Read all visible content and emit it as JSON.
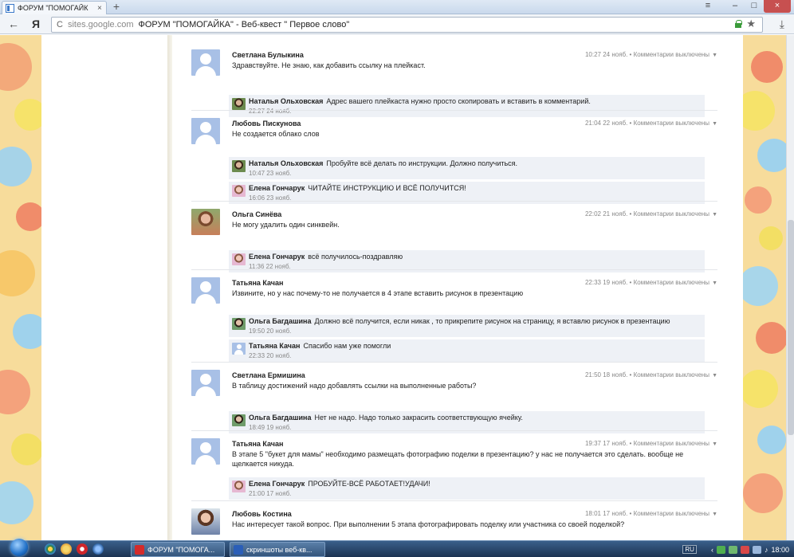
{
  "browser": {
    "tab_title": "ФОРУМ \"ПОМОГАЙК",
    "tab_close": "×",
    "new_tab": "+",
    "menu": "≡",
    "minimize": "–",
    "maximize": "□",
    "close": "×",
    "back": "←",
    "yandex": "Я",
    "reload": "C",
    "url_host": "sites.google.com",
    "url_title": "ФОРУМ \"ПОМОГАЙКА\" - Веб-квест \" Первое слово\"",
    "star": "★",
    "download": "⤓"
  },
  "comments": [
    {
      "author": "Светлана Булыкина",
      "text": "Здравствуйте. Не знаю, как добавить ссылку на плейкаст.",
      "meta": "10:27 24 нояб. • Комментарии выключены",
      "avatar": "default",
      "replies": [
        {
          "author": "Наталья Ольховская",
          "text": "Адрес вашего плейкаста нужно просто скопировать и вставить в комментарий.",
          "time": "22:27 24 нояб.",
          "avatar": "no"
        }
      ]
    },
    {
      "author": "Любовь Пискунова",
      "text": "Не создается облако слов",
      "meta": "21:04 22 нояб. • Комментарии выключены",
      "avatar": "default",
      "replies": [
        {
          "author": "Наталья Ольховская",
          "text": "Пробуйте всё делать по инструкции. Должно получиться.",
          "time": "10:47 23 нояб.",
          "avatar": "no"
        },
        {
          "author": "Елена Гончарук",
          "text": "ЧИТАЙТЕ ИНСТРУКЦИЮ И ВСЁ ПОЛУЧИТСЯ!",
          "time": "16:06 23 нояб.",
          "avatar": "eg"
        }
      ]
    },
    {
      "author": "Ольга Синёва",
      "text": "Не могу удалить один синквейн.",
      "meta": "22:02 21 нояб. • Комментарии выключены",
      "avatar": "photo",
      "replies": [
        {
          "author": "Елена Гончарук",
          "text": "всё получилось-поздравляю",
          "time": "11:36 22 нояб.",
          "avatar": "eg"
        }
      ]
    },
    {
      "author": "Татьяна Качан",
      "text": "Извините, но у нас почему-то не получается в 4 этапе вставить рисунок в презентацию",
      "meta": "22:33 19 нояб. • Комментарии выключены",
      "avatar": "default",
      "replies": [
        {
          "author": "Ольга Багдашина",
          "text": "Должно всё получится, если никак , то прикрепите рисунок на страницу, я вставлю рисунок в презентацию",
          "time": "19:50 20 нояб.",
          "avatar": "ob"
        },
        {
          "author": "Татьяна Качан",
          "text": "Спасибо нам уже помогли",
          "time": "22:33 20 нояб.",
          "avatar": "default"
        }
      ]
    },
    {
      "author": "Светлана Ермишина",
      "text": "В таблицу достижений надо добавлять ссылки на выполненные работы?",
      "meta": "21:50 18 нояб. • Комментарии выключены",
      "avatar": "default",
      "replies": [
        {
          "author": "Ольга Багдашина",
          "text": "Нет не надо. Надо только закрасить соответствующую ячейку.",
          "time": "18:49 19 нояб.",
          "avatar": "ob"
        }
      ]
    },
    {
      "author": "Татьяна Качан",
      "text": "В этапе 5 \"букет для мамы\" необходимо размещать фотографию поделки в презентацию? у нас не получается это сделать. вообще не щелкается никуда.",
      "meta": "19:37 17 нояб. • Комментарии выключены",
      "avatar": "default",
      "replies": [
        {
          "author": "Елена Гончарук",
          "text": "ПРОБУЙТЕ-ВСЁ РАБОТАЕТ!УДАЧИ!",
          "time": "21:00 17 нояб.",
          "avatar": "eg"
        }
      ]
    },
    {
      "author": "Любовь Костина",
      "text": "Нас интересует такой вопрос. При выполнении 5 этапа фотографировать поделку или участника со своей поделкой?",
      "meta": "18:01 17 нояб. • Комментарии выключены",
      "avatar": "photo2",
      "replies": []
    }
  ],
  "taskbar": {
    "task1": "ФОРУМ \"ПОМОГА...",
    "task2": "скриншоты веб-кв...",
    "lang": "RU",
    "clock": "18:00"
  },
  "colors": {
    "reply_bg": "#eef1f6",
    "avatar_default": "#a8c0e6",
    "side_pattern": "#f7dc9b"
  }
}
